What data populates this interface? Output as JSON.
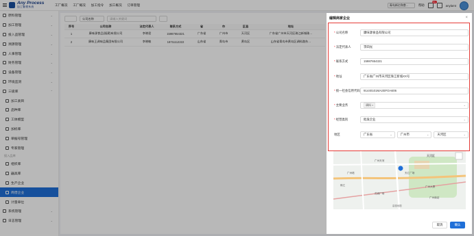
{
  "app": {
    "logo_title": "Any Process",
    "logo_sub": "加工管理系统"
  },
  "topnav": [
    {
      "label": "工厂概况",
      "icon": "home-icon"
    },
    {
      "label": "工厂概况"
    },
    {
      "label": "加工指令"
    },
    {
      "label": "加工概况"
    },
    {
      "label": "订单管理"
    }
  ],
  "topright": {
    "org_select": "青岛新亿和食...",
    "help": "帮助",
    "badge": "99+",
    "user": "anylamt"
  },
  "sidebar": {
    "items": [
      {
        "label": "原料管理",
        "icon": "box-icon",
        "chev": "v"
      },
      {
        "label": "加工管理",
        "icon": "scissors-icon",
        "chev": "v"
      },
      {
        "label": "投入品管理",
        "icon": "cart-icon",
        "chev": "v"
      },
      {
        "label": "溯源管理",
        "icon": "trace-icon",
        "chev": "v"
      },
      {
        "label": "人事管理",
        "icon": "people-icon",
        "chev": "v"
      },
      {
        "label": "财务管理",
        "icon": "money-icon",
        "chev": "v"
      },
      {
        "label": "设备管理",
        "icon": "device-icon",
        "chev": "v"
      },
      {
        "label": "环境监测",
        "icon": "env-icon",
        "chev": "v"
      },
      {
        "label": "三级库",
        "icon": "db-icon",
        "chev": "^"
      }
    ],
    "sub_items": [
      {
        "label": "加工类目",
        "icon": "gear-icon"
      },
      {
        "label": "品种库",
        "icon": "grid-icon"
      },
      {
        "label": "工体模型",
        "icon": "model-icon"
      },
      {
        "label": "加标库",
        "icon": "flag-icon"
      },
      {
        "label": "单据号管理",
        "icon": "clock-icon"
      },
      {
        "label": "专家管理",
        "icon": "expert-icon"
      }
    ],
    "group_label": "投入品库",
    "sub_items2": [
      {
        "label": "组织库",
        "icon": "circle-icon"
      },
      {
        "label": "器具库",
        "icon": "tool-icon"
      },
      {
        "label": "生产企业",
        "icon": "factory-icon"
      },
      {
        "label": "商借企业",
        "icon": "cart-icon",
        "active": true
      },
      {
        "label": "计量单位",
        "icon": "pin-icon"
      }
    ],
    "bottom_items": [
      {
        "label": "系统管理",
        "icon": "settings-icon",
        "chev": "v"
      },
      {
        "label": "日志管理",
        "icon": "log-icon",
        "chev": "v"
      }
    ]
  },
  "toolbar": {
    "select_value": "公司名称",
    "search_placeholder": "请输入关键词"
  },
  "table": {
    "headers": [
      "序号",
      "公司名称",
      "法定代表人",
      "联系方式",
      "省",
      "市",
      "区县",
      "地址"
    ],
    "rows": [
      [
        "1",
        "康味源食品(福建)有限公司",
        "李晓君",
        "15987654321",
        "广东省",
        "广州市",
        "天河区",
        "广东省广州市天河区珠江新城珠…"
      ],
      [
        "2",
        "康味王调味品集团有限公司",
        "李晓敏",
        "18711112222",
        "山东省",
        "青岛市",
        "黄岛区",
        "山东省青岛市黄岛区调料路东…"
      ]
    ]
  },
  "drawer": {
    "title": "编辑商家企业",
    "close": "×",
    "fields": {
      "company_label": "公司名称",
      "company_value": "康味源食品有限公司",
      "legal_label": "法定代表人",
      "legal_value": "李四光",
      "phone_label": "联系方式",
      "phone_value": "15987654321",
      "address_label": "地址",
      "address_value": "广东省广州市天河区珠江新城XX号",
      "credit_label": "统一社会信用代码",
      "credit_value": "91440101MA2EFGH406",
      "business_label": "主要业务",
      "business_tag": "调料",
      "grade_label": "经营类别",
      "grade_value": "批发企业",
      "region_label": "地区",
      "province": "广东省",
      "city": "广州市",
      "district": "天河区"
    },
    "cancel": "取消",
    "ok": "确认"
  },
  "map": {
    "labels": [
      "天河区",
      "广州天河",
      "广州塔",
      "天汇广场",
      "广州大厦",
      "珠江",
      "花城广场",
      "广州南站",
      "高德地图"
    ]
  },
  "colors": {
    "primary": "#1f6fd8",
    "highlight_border": "#e53935"
  }
}
